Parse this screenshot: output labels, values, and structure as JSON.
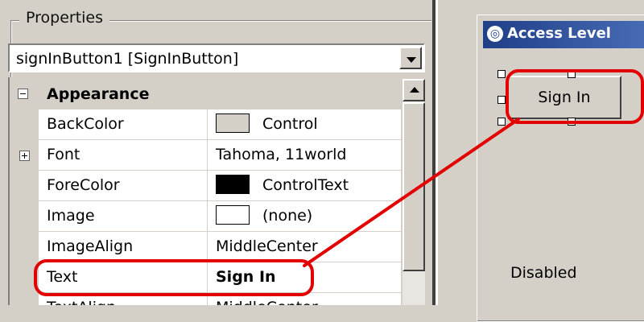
{
  "properties_panel": {
    "title": "Properties",
    "object_selector": "signInButton1 [SignInButton]",
    "category": "Appearance",
    "rows": [
      {
        "name": "BackColor",
        "value": "Control",
        "swatch": "#d4d0c8"
      },
      {
        "name": "Font",
        "value": "Tahoma, 11world"
      },
      {
        "name": "ForeColor",
        "value": "ControlText",
        "swatch": "#000000"
      },
      {
        "name": "Image",
        "value": "(none)",
        "swatch": "#ffffff"
      },
      {
        "name": "ImageAlign",
        "value": "MiddleCenter"
      },
      {
        "name": "Text",
        "value": "Sign In"
      },
      {
        "name": "TextAlign",
        "value": "MiddleCenter"
      }
    ]
  },
  "designer": {
    "form_title": "Access Level",
    "button_text": "Sign In",
    "status_label": "Disabled"
  },
  "colors": {
    "highlight": "#e30000",
    "titlebar": "#1f3f87",
    "panel": "#d4d0c8"
  }
}
